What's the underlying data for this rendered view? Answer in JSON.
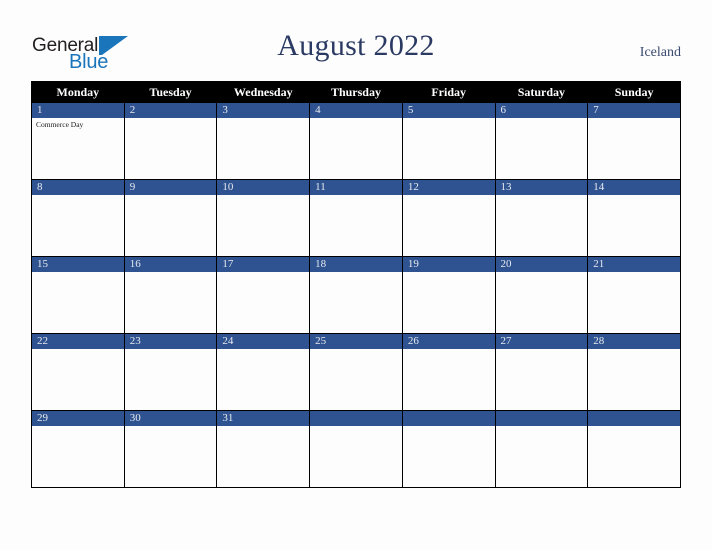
{
  "brand": {
    "name_part1": "General",
    "name_part2": "Blue",
    "mark_icon": "triangle-logo-icon"
  },
  "header": {
    "title": "August 2022",
    "country": "Iceland"
  },
  "calendar": {
    "weekday_headers": [
      "Monday",
      "Tuesday",
      "Wednesday",
      "Thursday",
      "Friday",
      "Saturday",
      "Sunday"
    ],
    "colors": {
      "header_background": "#000000",
      "header_text": "#ffffff",
      "day_band": "#2e5390",
      "day_band_text": "#e8eaf0",
      "cell_background": "#fdfdfd",
      "grid_border": "#000000",
      "title_text": "#2b3a63",
      "brand_blue": "#1b75bb",
      "page_background": "#fdfdfd"
    },
    "weeks": [
      [
        {
          "day": "1",
          "events": [
            "Commerce Day"
          ]
        },
        {
          "day": "2",
          "events": []
        },
        {
          "day": "3",
          "events": []
        },
        {
          "day": "4",
          "events": []
        },
        {
          "day": "5",
          "events": []
        },
        {
          "day": "6",
          "events": []
        },
        {
          "day": "7",
          "events": []
        }
      ],
      [
        {
          "day": "8",
          "events": []
        },
        {
          "day": "9",
          "events": []
        },
        {
          "day": "10",
          "events": []
        },
        {
          "day": "11",
          "events": []
        },
        {
          "day": "12",
          "events": []
        },
        {
          "day": "13",
          "events": []
        },
        {
          "day": "14",
          "events": []
        }
      ],
      [
        {
          "day": "15",
          "events": []
        },
        {
          "day": "16",
          "events": []
        },
        {
          "day": "17",
          "events": []
        },
        {
          "day": "18",
          "events": []
        },
        {
          "day": "19",
          "events": []
        },
        {
          "day": "20",
          "events": []
        },
        {
          "day": "21",
          "events": []
        }
      ],
      [
        {
          "day": "22",
          "events": []
        },
        {
          "day": "23",
          "events": []
        },
        {
          "day": "24",
          "events": []
        },
        {
          "day": "25",
          "events": []
        },
        {
          "day": "26",
          "events": []
        },
        {
          "day": "27",
          "events": []
        },
        {
          "day": "28",
          "events": []
        }
      ],
      [
        {
          "day": "29",
          "events": []
        },
        {
          "day": "30",
          "events": []
        },
        {
          "day": "31",
          "events": []
        },
        {
          "day": "",
          "events": []
        },
        {
          "day": "",
          "events": []
        },
        {
          "day": "",
          "events": []
        },
        {
          "day": "",
          "events": []
        }
      ]
    ]
  }
}
